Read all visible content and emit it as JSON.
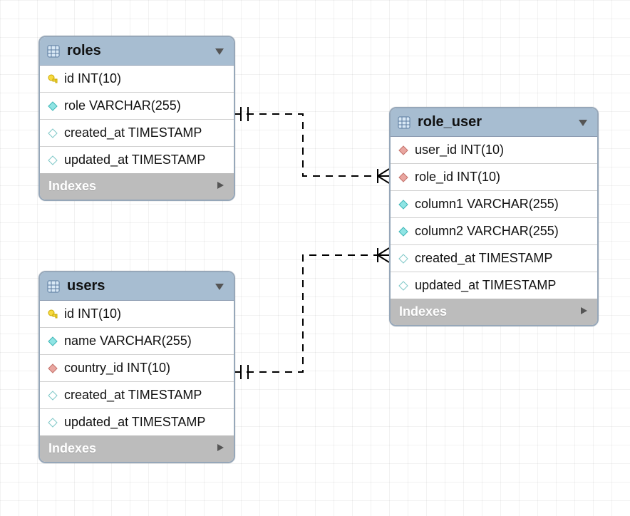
{
  "tables": {
    "roles": {
      "name": "roles",
      "columns": [
        {
          "icon": "pk",
          "label": "id INT(10)"
        },
        {
          "icon": "attr",
          "label": "role VARCHAR(255)"
        },
        {
          "icon": "null",
          "label": "created_at TIMESTAMP"
        },
        {
          "icon": "null",
          "label": "updated_at TIMESTAMP"
        }
      ]
    },
    "users": {
      "name": "users",
      "columns": [
        {
          "icon": "pk",
          "label": "id INT(10)"
        },
        {
          "icon": "attr",
          "label": "name VARCHAR(255)"
        },
        {
          "icon": "fk",
          "label": "country_id INT(10)"
        },
        {
          "icon": "null",
          "label": "created_at TIMESTAMP"
        },
        {
          "icon": "null",
          "label": "updated_at TIMESTAMP"
        }
      ]
    },
    "role_user": {
      "name": "role_user",
      "columns": [
        {
          "icon": "fk",
          "label": "user_id INT(10)"
        },
        {
          "icon": "fk",
          "label": "role_id INT(10)"
        },
        {
          "icon": "attr",
          "label": "column1 VARCHAR(255)"
        },
        {
          "icon": "attr",
          "label": "column2 VARCHAR(255)"
        },
        {
          "icon": "null",
          "label": "created_at TIMESTAMP"
        },
        {
          "icon": "null",
          "label": "updated_at TIMESTAMP"
        }
      ]
    }
  },
  "indexes_label": "Indexes",
  "relationships": [
    {
      "from": "roles.id",
      "to": "role_user.role_id",
      "type": "one-to-many"
    },
    {
      "from": "users.id",
      "to": "role_user.user_id",
      "type": "one-to-many"
    }
  ]
}
